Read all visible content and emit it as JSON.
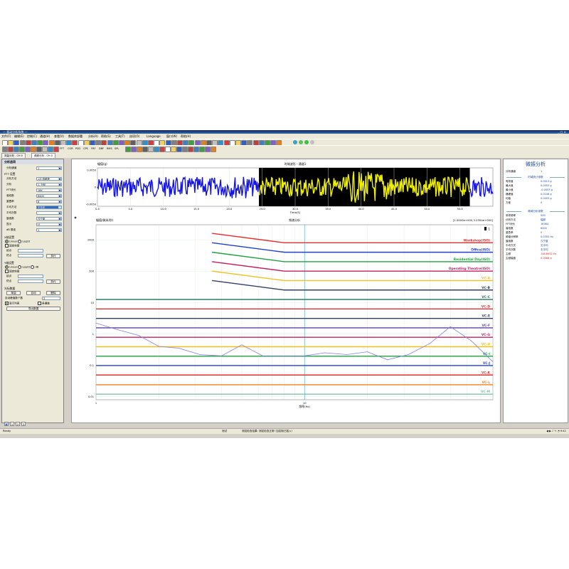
{
  "app": {
    "title": "— 振动分析系统 —",
    "window_controls": "_ □ ×"
  },
  "menu": [
    "文件(F)",
    "编辑(E)",
    "控制(C)",
    "通道(H)",
    "查看(V)",
    "数据库部署",
    "分析(A)",
    "帮助(S)",
    "工具(T)",
    "选项(O)",
    "Language",
    "窗口(W)",
    "帮助(H)"
  ],
  "toolbar": {
    "text_items": [
      "FFT",
      "COR",
      "PSD",
      "CPS",
      "FRF",
      "DBF",
      "RMS",
      "SPL"
    ]
  },
  "doc_tabs": [
    "测量分析 - CH 0",
    "频频分析 - CH 0"
  ],
  "left_panel": {
    "header": "分析选项",
    "rows": [
      {
        "label": "分析通道",
        "value": "1"
      },
      {
        "section": "FFT 设置"
      },
      {
        "label": "分析方法",
        "value": "1/3 倍频程"
      },
      {
        "label": "分析",
        "value": "1. 分析"
      },
      {
        "label": "FFT块长",
        "value": "16K"
      },
      {
        "label": "谱线数",
        "value": "6400"
      },
      {
        "label": "重叠率",
        "value": "8"
      },
      {
        "label": "平均方法",
        "value": "无平均",
        "highlight": true
      },
      {
        "label": "平均次数",
        "value": ""
      },
      {
        "label": "窗函数",
        "value": "汉宁窗"
      },
      {
        "label": "显示",
        "value": "计"
      },
      {
        "label": "dB 基准",
        "value": "1"
      }
    ],
    "x_axis": {
      "section": "X轴设置",
      "radio_linear": "Linear",
      "radio_log": "Log10",
      "check_fixed": "固定刻度",
      "start_label": "起点",
      "end_label": "终点",
      "apply_button": "执行"
    },
    "y_axis": {
      "section": "Y轴设置",
      "radio_linear": "Linear",
      "radio_log": "Log10",
      "radio_db": "dB",
      "check_fixed": "固定刻度",
      "start_label": "起点",
      "end_label": "终点",
      "apply_button": "执行"
    },
    "cursor": {
      "section": "光标数据",
      "btn_single": "单曲",
      "btn_auto": "自动",
      "btn_delete": "删除",
      "peak_count_label": "自动峰值数个数",
      "peak_count_value": "3",
      "check_show_table": "显示列表",
      "check_multi": "各通道",
      "export_button": "导出数据"
    }
  },
  "time_chart": {
    "title": "时域波形 - 通道1",
    "ylabel": "幅值(g)",
    "xlabel": "Time(S)",
    "yticks": [
      "0.0050",
      "0",
      "-0.0050"
    ],
    "xticks": [
      "0.0",
      "5.0",
      "10.0",
      "15.0",
      "20.0",
      "25.0",
      "30.0",
      "35.0",
      "40.0",
      "45.0",
      "50.0",
      "55.0"
    ],
    "xlim": [
      0,
      60
    ],
    "selection": [
      24.5,
      56.5
    ],
    "colors": {
      "signal": "#1414e6",
      "selected_signal": "#f0f000",
      "selected_bg": "#000000",
      "grid": "#cfe6cf"
    }
  },
  "chart_data": {
    "type": "line",
    "title": "频谱分析",
    "ylabel": "幅值(微米/秒)",
    "xlabel": "频率(Hz)",
    "readout": "[1.0000e+000,3.2394e+000]",
    "legend_marker": "1",
    "x_scale": "log",
    "y_scale": "log",
    "xlim": [
      1,
      80
    ],
    "ylim": [
      0.008,
      3000
    ],
    "xticks": [
      "1",
      "10"
    ],
    "yticks": [
      "1000",
      "100",
      "10",
      "1",
      "0.1",
      "0.01"
    ],
    "criteria_curves": [
      {
        "name": "Workshop(ISO)",
        "color": "#e03030",
        "y_left": 1600,
        "y_right": 800
      },
      {
        "name": "Office(ISO)",
        "color": "#2040d0",
        "y_left": 800,
        "y_right": 400
      },
      {
        "name": "Residential Day(ISO)",
        "color": "#20a040",
        "y_left": 400,
        "y_right": 200
      },
      {
        "name": "Operating Theatre(ISO)",
        "color": "#c02060",
        "y_left": 200,
        "y_right": 100
      },
      {
        "name": "VC-A",
        "color": "#f0c020",
        "y_left": 100,
        "y_right": 50
      },
      {
        "name": "VC-B",
        "color": "#304060",
        "y_left": 50,
        "y_right": 25
      }
    ],
    "criteria_lines": [
      {
        "name": "VC-C",
        "color": "#207060",
        "y": 12.5
      },
      {
        "name": "VC-D",
        "color": "#e03030",
        "y": 6.25
      },
      {
        "name": "VC-E",
        "color": "#304060",
        "y": 3.12
      },
      {
        "name": "VC-F",
        "color": "#6040a0",
        "y": 1.56
      },
      {
        "name": "VC-G",
        "color": "#c02060",
        "y": 0.78
      },
      {
        "name": "VC-H",
        "color": "#f0c020",
        "y": 0.39
      },
      {
        "name": "VC-I",
        "color": "#20a040",
        "y": 0.195
      },
      {
        "name": "VC-J",
        "color": "#2040d0",
        "y": 0.098
      },
      {
        "name": "VC-K",
        "color": "#e03030",
        "y": 0.049
      },
      {
        "name": "VC-L",
        "color": "#f08020",
        "y": 0.024
      },
      {
        "name": "VC-M",
        "color": "#80c0b0",
        "y": 0.012
      }
    ],
    "series": [
      {
        "color": "#8080e0",
        "x": [
          1,
          1.25,
          1.6,
          2,
          2.5,
          3.15,
          4,
          5,
          6.3,
          8,
          10,
          12.5,
          16,
          20,
          25,
          31.5,
          40,
          50,
          63,
          80
        ],
        "y": [
          2.2,
          1.4,
          0.9,
          0.4,
          0.35,
          0.22,
          0.2,
          0.45,
          0.2,
          0.2,
          0.2,
          0.25,
          0.22,
          0.27,
          0.15,
          0.22,
          0.5,
          1.7,
          0.6,
          0.13
        ]
      }
    ]
  },
  "right_panel": {
    "title": "微振分析",
    "channel_label": "分析通道",
    "channel_value": "1",
    "time_section": "时域统计参数",
    "time_stats": [
      {
        "k": "有效值",
        "v": "0.0013 g"
      },
      {
        "k": "最大值",
        "v": "0.0053 g"
      },
      {
        "k": "最小值",
        "v": "-0.0053 g"
      },
      {
        "k": "峰峰值",
        "v": "0.0106 g"
      },
      {
        "k": "均值",
        "v": "0.0003 g"
      },
      {
        "k": "方差",
        "v": "0"
      }
    ],
    "freq_section": "频域分析参数",
    "freq_stats": [
      {
        "k": "采样频率",
        "v": "500"
      },
      {
        "k": "分析方法",
        "v": "幅频"
      },
      {
        "k": "FFT块长",
        "v": "16384"
      },
      {
        "k": "谱线数",
        "v": "6400"
      },
      {
        "k": "重叠率",
        "v": "0"
      },
      {
        "k": "频谱分辨率",
        "v": "0.0305 Hz"
      },
      {
        "k": "窗函数",
        "v": "汉宁窗"
      },
      {
        "k": "平均方式",
        "v": "无平均"
      },
      {
        "k": "平均次数",
        "v": "无平均"
      },
      {
        "k": "主频",
        "v": "148.8052 Hz",
        "red": true
      },
      {
        "k": "主频幅值",
        "v": "0.0088 g",
        "red": true
      }
    ]
  },
  "bottom_tabs": [
    "A",
    "1",
    "2",
    "3"
  ],
  "status": {
    "left": "Ready",
    "mid": "测试",
    "msg": "测控检查结果: 测控检查正常! 加控制已插入!",
    "tray": "◀ ▶ ♪ ✎ ◔ 9:41"
  }
}
